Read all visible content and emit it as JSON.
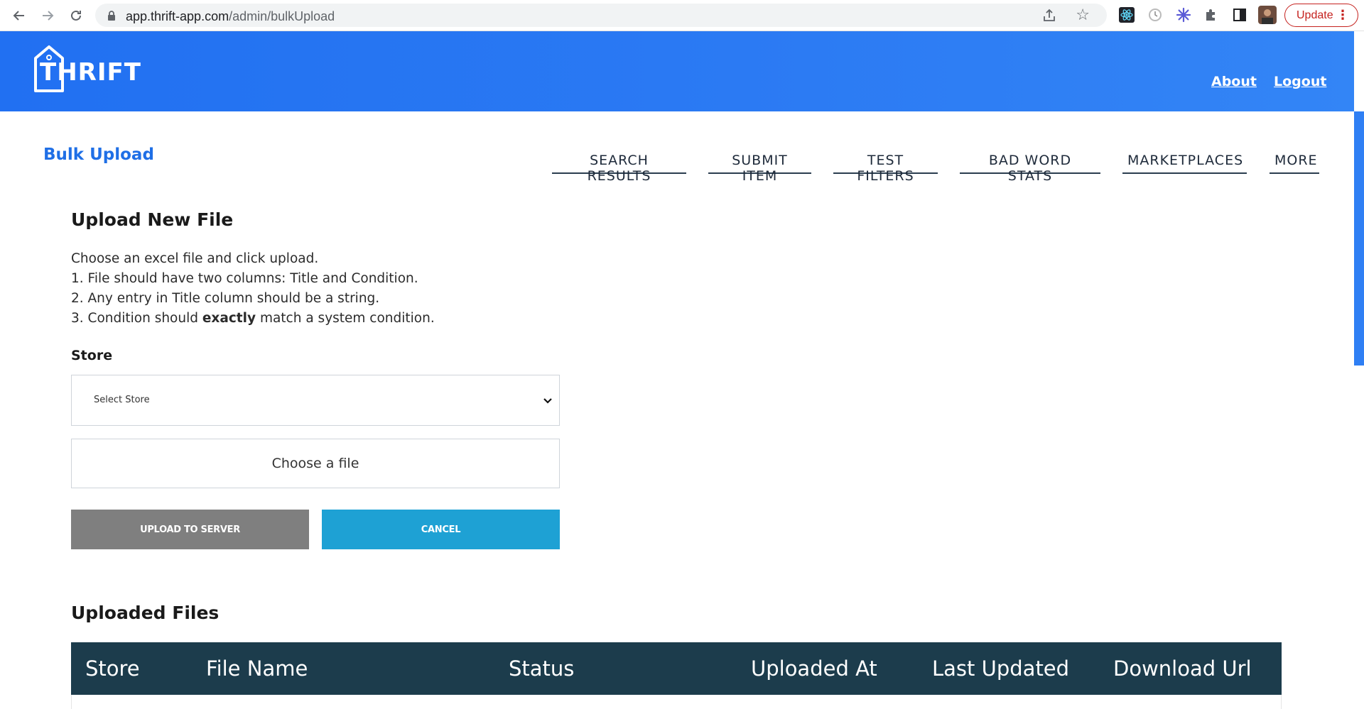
{
  "browser": {
    "url_host": "app.thrift-app.com",
    "url_path": "/admin/bulkUpload",
    "update_label": "Update"
  },
  "header": {
    "logo_text": "THRIFT",
    "links": [
      {
        "label": "About"
      },
      {
        "label": "Logout"
      }
    ]
  },
  "page": {
    "title": "Bulk Upload"
  },
  "subnav": {
    "items": [
      {
        "label": "SEARCH RESULTS"
      },
      {
        "label": "SUBMIT ITEM"
      },
      {
        "label": "TEST FILTERS"
      },
      {
        "label": "BAD WORD STATS"
      },
      {
        "label": "MARKETPLACES"
      },
      {
        "label": "MORE"
      }
    ]
  },
  "upload": {
    "title": "Upload New File",
    "intro": "Choose an excel file and click upload.",
    "rule1": "1. File should have two columns: Title and Condition.",
    "rule2": "2. Any entry in Title column should be a string.",
    "rule3_before": "3. Condition should ",
    "rule3_bold": "exactly",
    "rule3_after": " match a system condition.",
    "store_label": "Store",
    "store_selected": "Select Store",
    "file_label": "Choose a file",
    "upload_button": "UPLOAD TO SERVER",
    "cancel_button": "CANCEL"
  },
  "files": {
    "title": "Uploaded Files",
    "columns": [
      "Store",
      "File Name",
      "Status",
      "Uploaded At",
      "Last Updated",
      "Download Url"
    ]
  },
  "colors": {
    "header_blue": "#2170f2",
    "title_blue": "#1f6fe6",
    "table_head": "#1c3c4c",
    "cancel": "#1ea1d4",
    "upload": "#7f7f7f"
  }
}
